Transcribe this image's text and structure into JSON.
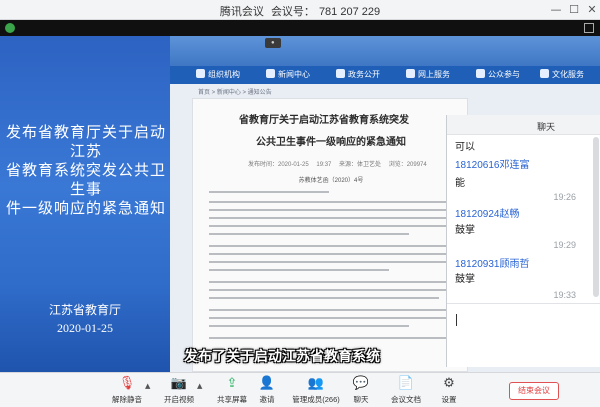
{
  "window": {
    "app_name": "腾讯会议",
    "meeting_id_label": "会议号：",
    "meeting_id": "781 207 229",
    "min_glyph": "—",
    "max_glyph": "☐",
    "close_glyph": "✕"
  },
  "slide": {
    "heading_lines": [
      "发布省教育厅关于启动江苏",
      "省教育系统突发公共卫生事",
      "件一级响应的紧急通知"
    ],
    "org": "江苏省教育厅",
    "date": "2020-01-25"
  },
  "webpage": {
    "nav": [
      {
        "label": "组织机构",
        "icon": "org-icon"
      },
      {
        "label": "新闻中心",
        "icon": "news-icon"
      },
      {
        "label": "政务公开",
        "icon": "gov-icon"
      },
      {
        "label": "网上服务",
        "icon": "service-icon"
      },
      {
        "label": "公众参与",
        "icon": "public-icon"
      },
      {
        "label": "文化服务",
        "icon": "culture-icon"
      }
    ],
    "breadcrumb": "首页 > 新闻中心 > 通知公告",
    "article_title_line1": "省教育厅关于启动江苏省教育系统突发",
    "article_title_line2": "公共卫生事件一级响应的紧急通知",
    "article_meta": "发布时间：2020-01-25 19:37 来源：体卫艺处 浏览：209974",
    "doc_number": "苏教体艺函（2020）4号"
  },
  "caption": "发布了关于启动江苏省教育系统",
  "chat": {
    "header": "聊天",
    "messages": [
      {
        "kind": "text",
        "value": "可以"
      },
      {
        "kind": "sender",
        "value": "18120616邓连富"
      },
      {
        "kind": "text",
        "value": "能"
      },
      {
        "kind": "time",
        "value": "19:26"
      },
      {
        "kind": "sender",
        "value": "18120924赵畅"
      },
      {
        "kind": "text",
        "value": "鼓掌"
      },
      {
        "kind": "time",
        "value": "19:29"
      },
      {
        "kind": "sender",
        "value": "18120931顾雨哲"
      },
      {
        "kind": "text",
        "value": "鼓掌"
      },
      {
        "kind": "time",
        "value": "19:33"
      }
    ]
  },
  "toolbar": {
    "items": [
      {
        "label": "解除静音",
        "icon": "mic-muted-icon",
        "glyph": "🎙"
      },
      {
        "label": "开启视频",
        "icon": "video-off-icon",
        "glyph": "📷"
      },
      {
        "label": "共享屏幕",
        "icon": "share-screen-icon",
        "glyph": "⇪"
      },
      {
        "label": "邀请",
        "icon": "invite-icon",
        "glyph": "👤"
      },
      {
        "label": "管理成员(266)",
        "icon": "members-icon",
        "glyph": "👥"
      },
      {
        "label": "聊天",
        "icon": "chat-icon",
        "glyph": "💬"
      },
      {
        "label": "会议文档",
        "icon": "docs-icon",
        "glyph": "📄"
      },
      {
        "label": "设置",
        "icon": "settings-icon",
        "glyph": "⚙"
      }
    ],
    "end_label": "结束会议",
    "caret_glyph": "▲"
  },
  "colors": {
    "accent": "#2863d3",
    "end_red": "#e03e3e",
    "slide_blue": "#3a78d6"
  }
}
